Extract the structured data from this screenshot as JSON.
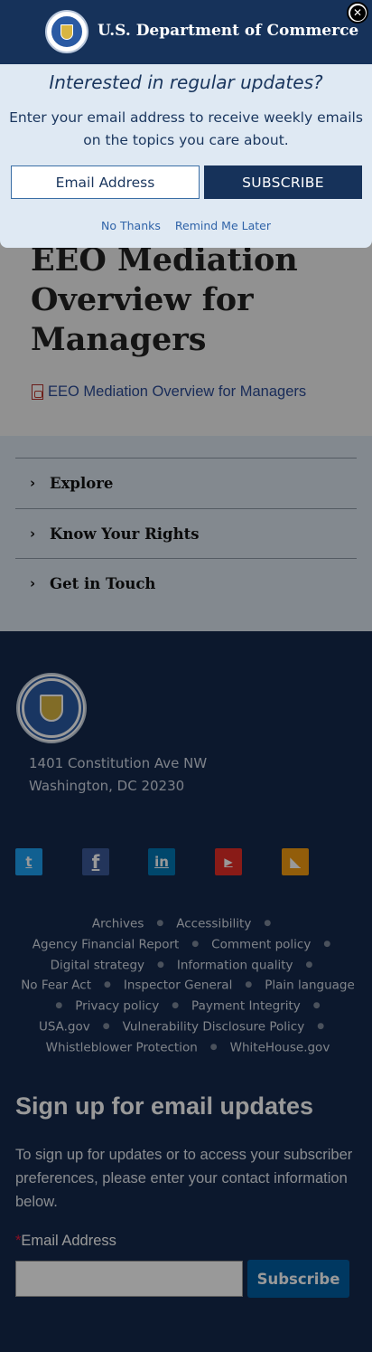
{
  "page": {
    "title": "EEO Mediation Overview for Managers",
    "pdf_link": "EEO Mediation Overview for Managers",
    "accordion": [
      {
        "label": "Explore"
      },
      {
        "label": "Know Your Rights"
      },
      {
        "label": "Get in Touch"
      }
    ]
  },
  "footer": {
    "address_line1": "1401 Constitution Ave NW",
    "address_line2": "Washington, DC 20230",
    "social": [
      {
        "name": "twitter-icon",
        "glyph": "t"
      },
      {
        "name": "facebook-icon",
        "glyph": "f"
      },
      {
        "name": "linkedin-icon",
        "glyph": "in"
      },
      {
        "name": "youtube-icon",
        "glyph": "▶"
      },
      {
        "name": "rss-icon",
        "glyph": "◣"
      }
    ],
    "links": [
      "Archives",
      "Accessibility",
      "Agency Financial Report",
      "Comment policy",
      "Digital strategy",
      "Information quality",
      "No Fear Act",
      "Inspector General",
      "Plain language",
      "Privacy policy",
      "Payment Integrity",
      "USA.gov",
      "Vulnerability Disclosure Policy",
      "Whistleblower Protection",
      "WhiteHouse.gov"
    ],
    "signup": {
      "title": "Sign up for email updates",
      "description": "To sign up for updates or to access your subscriber preferences, please enter your contact information below.",
      "required_mark": "*",
      "email_label": "Email Address",
      "email_value": "",
      "button": "Subscribe"
    }
  },
  "modal": {
    "brand": "U.S. Department of Commerce",
    "close_glyph": "✕",
    "headline": "Interested in regular updates?",
    "description": "Enter your email address to receive weekly emails on the topics you care about.",
    "email_placeholder": "Email Address",
    "subscribe_label": "SUBSCRIBE",
    "no_thanks": "No Thanks",
    "remind_later": "Remind Me Later"
  },
  "colors": {
    "brand_navy": "#16325a",
    "footer_bg": "#14284b",
    "link_blue": "#2f63a8",
    "subscribe_blue": "#005ea2",
    "required_red": "#e31c3d"
  }
}
